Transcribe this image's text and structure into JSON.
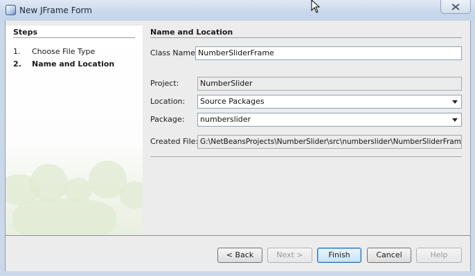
{
  "window": {
    "title": "New JFrame Form"
  },
  "steps": {
    "title": "Steps",
    "items": [
      {
        "num": "1.",
        "label": "Choose File Type"
      },
      {
        "num": "2.",
        "label": "Name and Location"
      }
    ]
  },
  "section": {
    "title": "Name and Location"
  },
  "form": {
    "class_name": {
      "label": "Class Name:",
      "value": "NumberSliderFrame"
    },
    "project": {
      "label": "Project:",
      "value": "NumberSlider"
    },
    "location": {
      "label": "Location:",
      "value": "Source Packages"
    },
    "package": {
      "label": "Package:",
      "value": "numberslider"
    },
    "created_file": {
      "label": "Created File:",
      "value": "G:\\NetBeansProjects\\NumberSlider\\src\\numberslider\\NumberSliderFrame.java"
    }
  },
  "buttons": {
    "back": "< Back",
    "next": "Next >",
    "finish": "Finish",
    "cancel": "Cancel",
    "help": "Help"
  },
  "icons": {
    "window": "netbeans-app-icon",
    "close": "close-icon",
    "cursor": "mouse-cursor-icon"
  }
}
